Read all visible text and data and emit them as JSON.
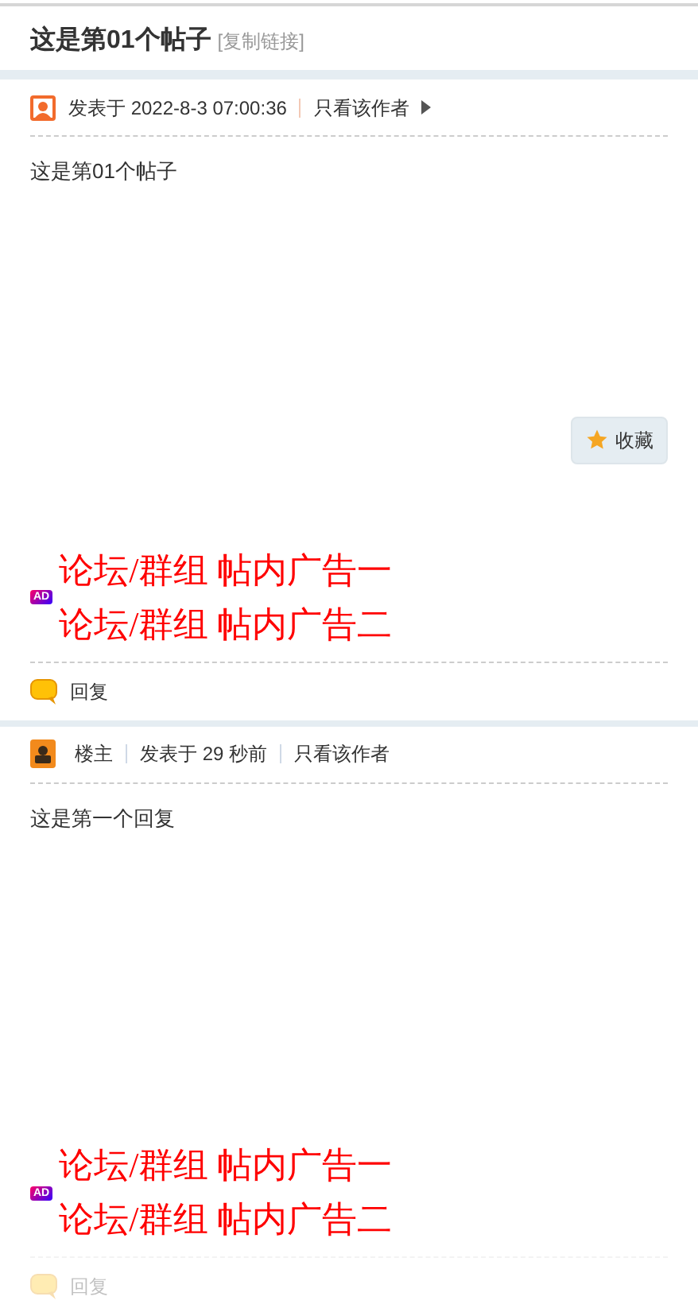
{
  "thread": {
    "title": "这是第01个帖子",
    "copy_link": "[复制链接]"
  },
  "posts": [
    {
      "kind": "member",
      "posted": "发表于 2022-8-3 07:00:36",
      "only_author": "只看该作者",
      "has_arrow": true,
      "body": "这是第01个帖子",
      "favorite": "收藏",
      "ad_badge": "AD",
      "ads": [
        "论坛/群组 帖内广告一",
        "论坛/群组 帖内广告二"
      ],
      "reply": "回复",
      "faded": false
    },
    {
      "kind": "owner",
      "author_label": "楼主",
      "posted": "发表于 29 秒前",
      "only_author": "只看该作者",
      "has_arrow": false,
      "body": "这是第一个回复",
      "ad_badge": "AD",
      "ads": [
        "论坛/群组 帖内广告一",
        "论坛/群组 帖内广告二"
      ],
      "reply": "回复",
      "faded": true
    }
  ]
}
